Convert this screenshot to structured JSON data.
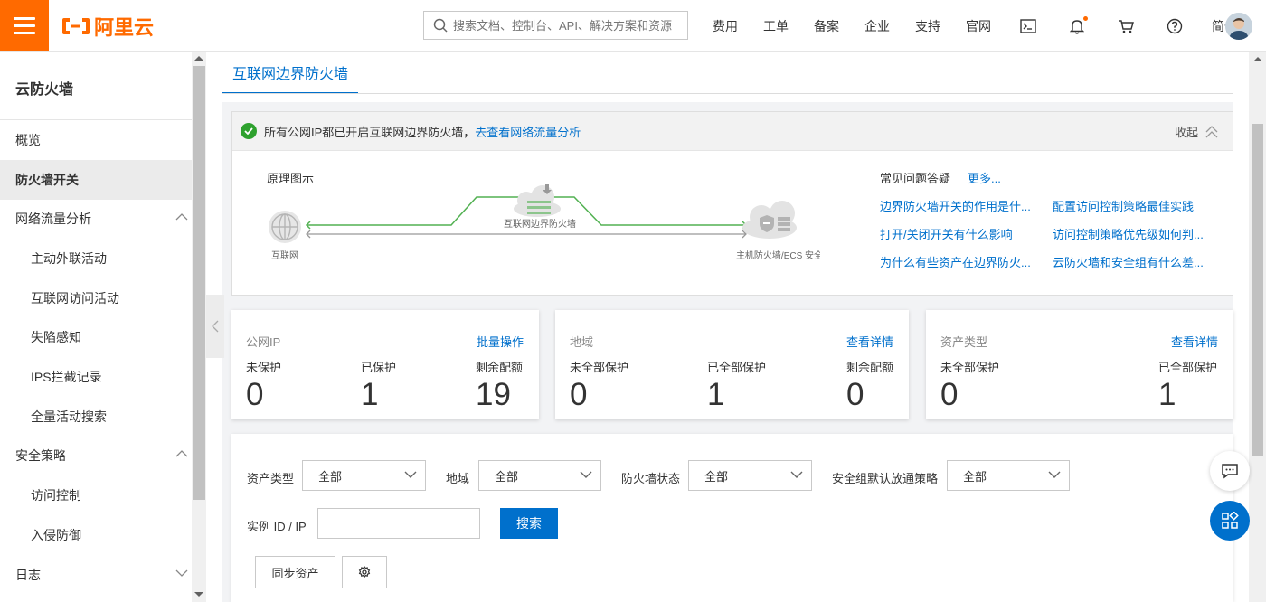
{
  "header": {
    "logo_text": "阿里云",
    "search_placeholder": "搜索文档、控制台、API、解决方案和资源",
    "nav": [
      "费用",
      "工单",
      "备案",
      "企业",
      "支持",
      "官网"
    ],
    "lang": "简体"
  },
  "sidebar": {
    "title": "云防火墙",
    "items": [
      {
        "label": "概览"
      },
      {
        "label": "防火墙开关"
      },
      {
        "label": "网络流量分析"
      },
      {
        "label": "主动外联活动"
      },
      {
        "label": "互联网访问活动"
      },
      {
        "label": "失陷感知"
      },
      {
        "label": "IPS拦截记录"
      },
      {
        "label": "全量活动搜索"
      },
      {
        "label": "安全策略"
      },
      {
        "label": "访问控制"
      },
      {
        "label": "入侵防御"
      },
      {
        "label": "日志"
      }
    ]
  },
  "main": {
    "tab": "互联网边界防火墙",
    "notice": {
      "text": "所有公网IP都已开启互联网边界防火墙，",
      "link": "去查看网络流量分析",
      "collapse": "收起"
    },
    "diagram": {
      "title": "原理图示",
      "internet": "互联网",
      "firewall": "互联网边界防火墙",
      "host": "主机防火墙/ECS 安全组"
    },
    "faq": {
      "title": "常见问题答疑",
      "more": "更多...",
      "links": [
        "边界防火墙开关的作用是什...",
        "配置访问控制策略最佳实践",
        "打开/关闭开关有什么影响",
        "访问控制策略优先级如何判...",
        "为什么有些资产在边界防火...",
        "云防火墙和安全组有什么差..."
      ]
    },
    "cards": [
      {
        "title": "公网IP",
        "link": "批量操作",
        "stats": [
          {
            "label": "未保护",
            "value": "0"
          },
          {
            "label": "已保护",
            "value": "1"
          },
          {
            "label": "剩余配额",
            "value": "19"
          }
        ]
      },
      {
        "title": "地域",
        "link": "查看详情",
        "stats": [
          {
            "label": "未全部保护",
            "value": "0"
          },
          {
            "label": "已全部保护",
            "value": "1"
          },
          {
            "label": "剩余配额",
            "value": "0"
          }
        ]
      },
      {
        "title": "资产类型",
        "link": "查看详情",
        "stats": [
          {
            "label": "未全部保护",
            "value": "0"
          },
          {
            "label": "已全部保护",
            "value": "1"
          }
        ]
      }
    ],
    "filters": {
      "asset_type_label": "资产类型",
      "asset_type_value": "全部",
      "region_label": "地域",
      "region_value": "全部",
      "fw_status_label": "防火墙状态",
      "fw_status_value": "全部",
      "sg_policy_label": "安全组默认放通策略",
      "sg_policy_value": "全部",
      "instance_label": "实例 ID / IP",
      "instance_value": "",
      "search_btn": "搜索",
      "sync_btn": "同步资产"
    }
  },
  "colors": {
    "brand": "#ff6a00",
    "primary": "#0070cc",
    "success": "#2ea12e"
  }
}
